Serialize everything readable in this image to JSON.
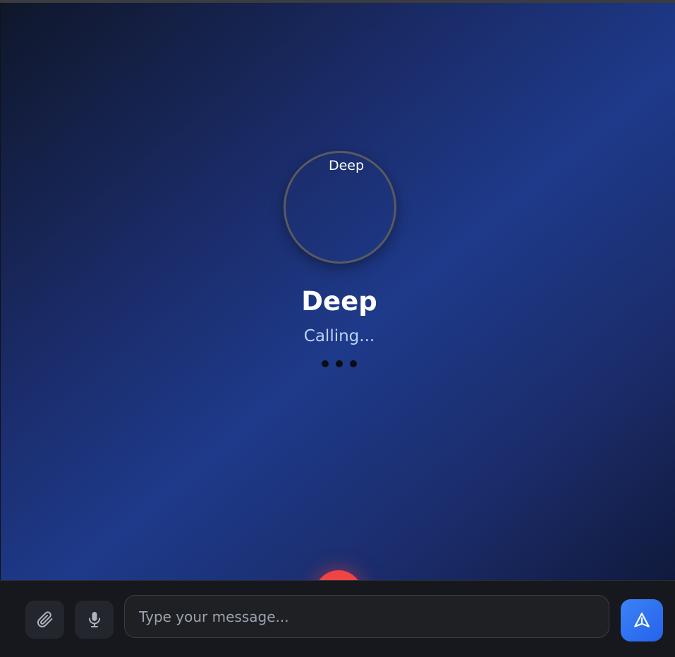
{
  "call": {
    "avatar_alt": "Deep",
    "caller_name": "Deep",
    "status": "Calling..."
  },
  "composer": {
    "placeholder": "Type your message..."
  },
  "icons": {
    "attach": "paperclip-icon",
    "mic": "microphone-icon",
    "send": "send-icon"
  },
  "colors": {
    "end_call": "#ef4444",
    "send_button": "#3b82f6",
    "background_gradient": [
      "#0f172a",
      "#1e3a8a"
    ]
  }
}
